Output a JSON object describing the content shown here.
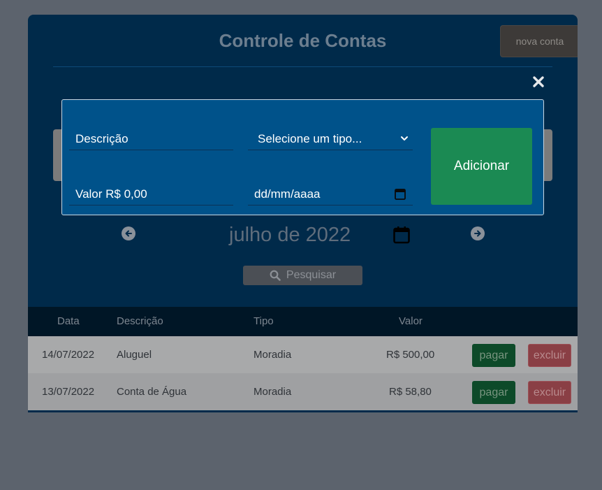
{
  "app": {
    "title": "Controle de Contas",
    "new_button": "nova conta"
  },
  "modal": {
    "description_placeholder": "Descrição",
    "type_select": "Selecione um tipo...",
    "value_placeholder": "Valor R$ 0,00",
    "date_placeholder": "dd/mm/aaaa",
    "add_button": "Adicionar"
  },
  "month_nav": {
    "label": "julho de 2022"
  },
  "search": {
    "label": "Pesquisar"
  },
  "table": {
    "headers": {
      "date": "Data",
      "description": "Descrição",
      "type": "Tipo",
      "value": "Valor"
    },
    "rows": [
      {
        "date": "14/07/2022",
        "description": "Aluguel",
        "type": "Moradia",
        "value": "R$ 500,00",
        "pay": "pagar",
        "delete": "excluir"
      },
      {
        "date": "13/07/2022",
        "description": "Conta de Água",
        "type": "Moradia",
        "value": "R$ 58,80",
        "pay": "pagar",
        "delete": "excluir"
      }
    ]
  },
  "colors": {
    "card_background": "#002a4a",
    "modal_background": "#00528a",
    "add_button": "#1b8a53",
    "pay_button": "#0d4a29",
    "delete_button": "#8a3f45"
  },
  "icons": [
    "close-icon",
    "chevron-down-icon",
    "calendar-icon",
    "arrow-left-icon",
    "arrow-right-icon",
    "search-icon"
  ]
}
